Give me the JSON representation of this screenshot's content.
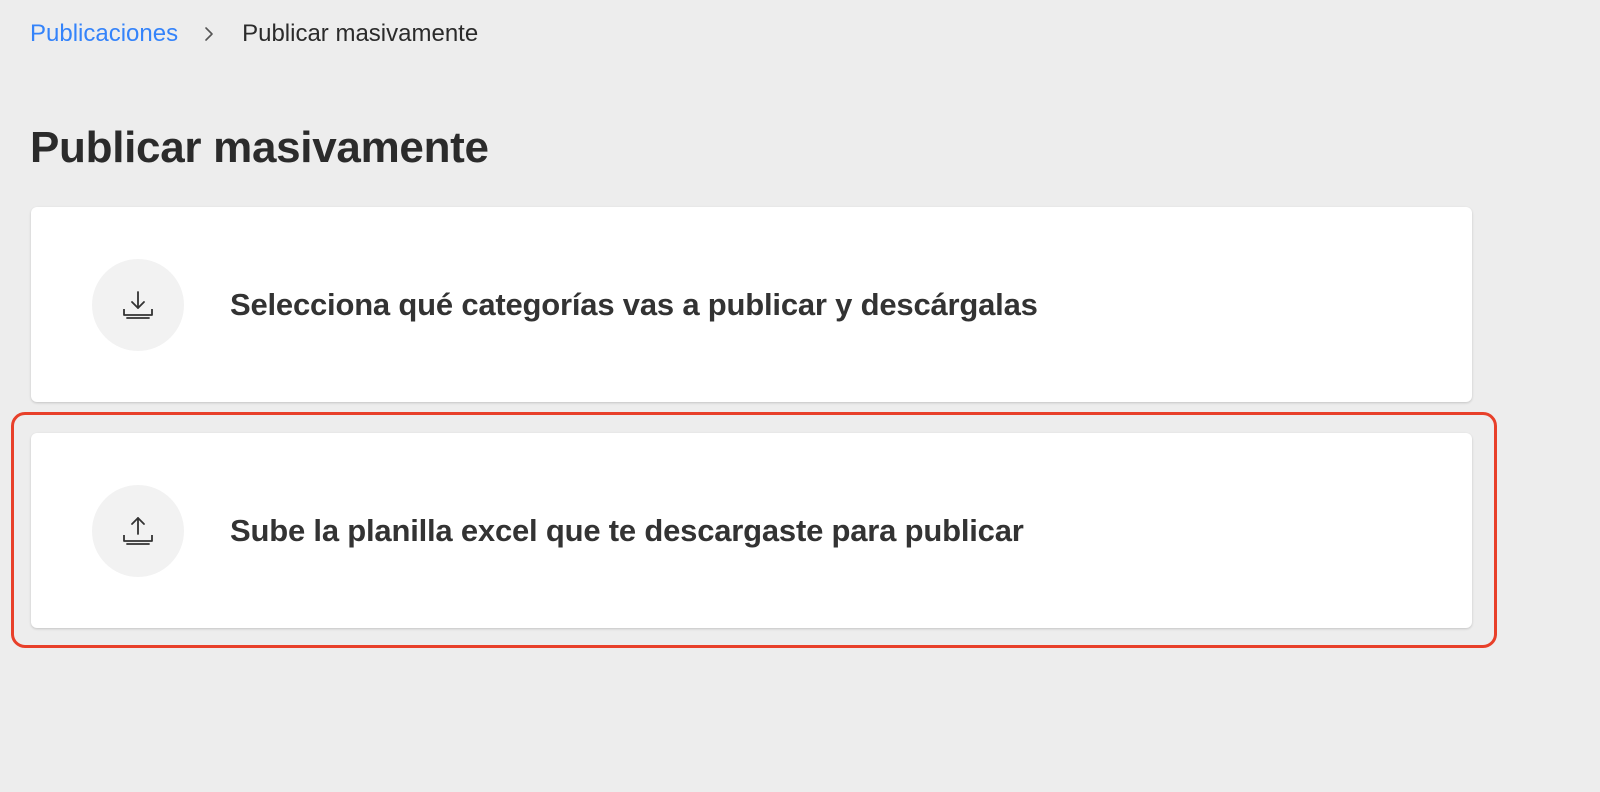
{
  "breadcrumb": {
    "parent": "Publicaciones",
    "current": "Publicar masivamente",
    "separator_icon": "chevron-right-icon"
  },
  "page": {
    "title": "Publicar masivamente"
  },
  "steps": [
    {
      "icon": "download-icon",
      "label": "Selecciona qué categorías vas a publicar y descárgalas"
    },
    {
      "icon": "upload-icon",
      "label": "Sube la planilla excel que te descargaste para publicar",
      "highlighted": true
    }
  ],
  "colors": {
    "link": "#3483fa",
    "background": "#ededed",
    "highlight": "#e8402a"
  }
}
